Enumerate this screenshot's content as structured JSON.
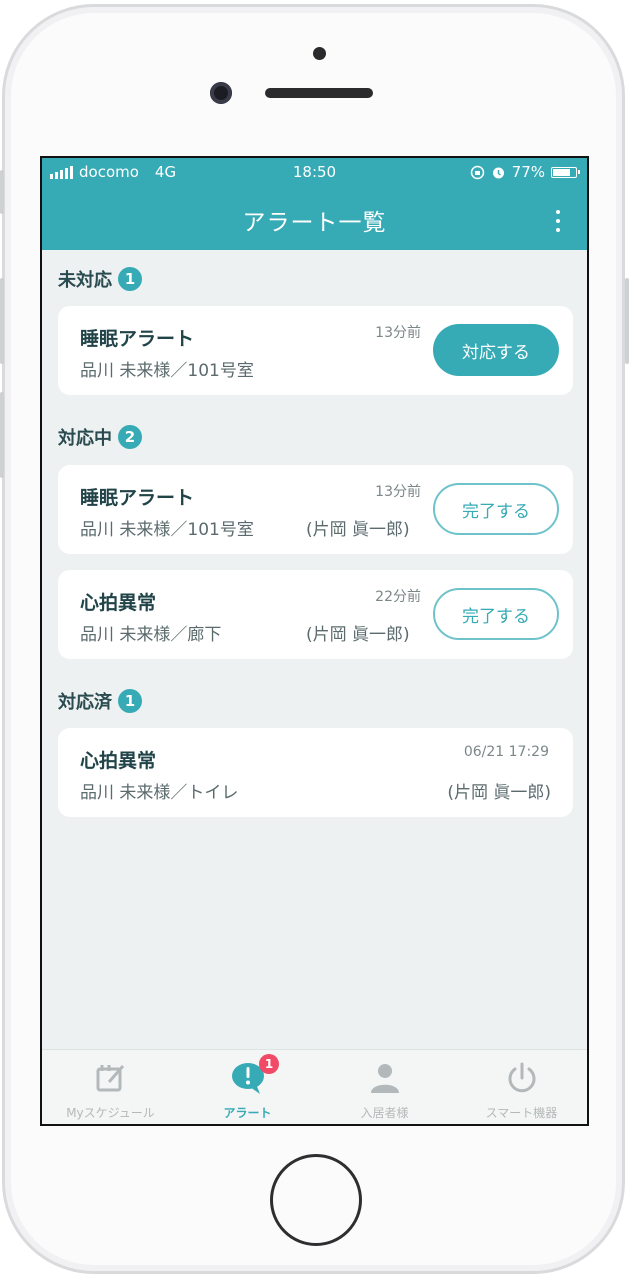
{
  "status_bar": {
    "carrier": "docomo",
    "network": "4G",
    "time": "18:50",
    "battery": "77%"
  },
  "nav": {
    "title": "アラート一覧"
  },
  "sections": [
    {
      "title": "未対応",
      "count": "1",
      "alerts": [
        {
          "title": "睡眠アラート",
          "resident": "品川 未来様／101号室",
          "time": "13分前",
          "staff": "",
          "action": "対応する"
        }
      ]
    },
    {
      "title": "対応中",
      "count": "2",
      "alerts": [
        {
          "title": "睡眠アラート",
          "resident": "品川 未来様／101号室",
          "time": "13分前",
          "staff": "(片岡 眞一郎)",
          "action": "完了する"
        },
        {
          "title": "心拍異常",
          "resident": "品川 未来様／廊下",
          "time": "22分前",
          "staff": "(片岡 眞一郎)",
          "action": "完了する"
        }
      ]
    },
    {
      "title": "対応済",
      "count": "1",
      "alerts": [
        {
          "title": "心拍異常",
          "resident": "品川 未来様／トイレ",
          "time": "06/21 17:29",
          "staff": "(片岡 眞一郎)",
          "action": ""
        }
      ]
    }
  ],
  "tab_bar": {
    "tabs": [
      {
        "label": "Myスケジュール",
        "icon": "schedule-edit-icon"
      },
      {
        "label": "アラート",
        "icon": "alert-bubble-icon",
        "badge": "1"
      },
      {
        "label": "入居者様",
        "icon": "person-icon"
      },
      {
        "label": "スマート機器",
        "icon": "power-icon"
      }
    ]
  },
  "colors": {
    "accent": "#36aab5",
    "background": "#edf1f1",
    "badge": "#f04a67"
  }
}
